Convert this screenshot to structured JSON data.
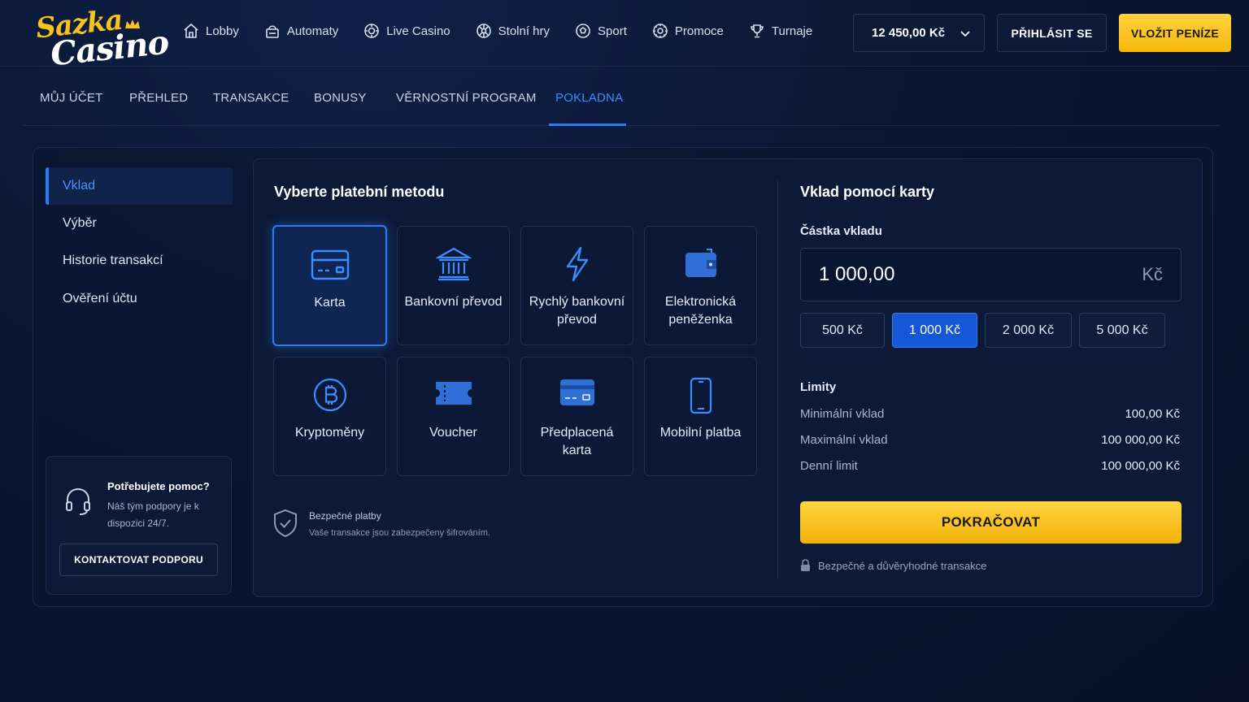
{
  "brand": {
    "logo_top": "Sazka",
    "logo_bottom": "Casino",
    "accent": "#f7c21b",
    "primary_blue": "#2f7cf0"
  },
  "nav": [
    {
      "label": "Lobby",
      "icon": "home-icon"
    },
    {
      "label": "Automaty",
      "icon": "slot-machine-icon"
    },
    {
      "label": "Live Casino",
      "icon": "chip-icon"
    },
    {
      "label": "Stolní hry",
      "icon": "roulette-icon"
    },
    {
      "label": "Sport",
      "icon": "soccer-ball-icon"
    },
    {
      "label": "Promoce",
      "icon": "gift-icon"
    },
    {
      "label": "Turnaje",
      "icon": "trophy-icon"
    }
  ],
  "header": {
    "balance": "12 450,00 Kč",
    "login_label": "PŘIHLÁSIT SE",
    "deposit_label": "VLOŽIT PENÍZE"
  },
  "tabs": [
    {
      "label": "MŮJ ÚČET"
    },
    {
      "label": "PŘEHLED"
    },
    {
      "label": "TRANSAKCE"
    },
    {
      "label": "BONUSY"
    },
    {
      "label": "VĚRNOSTNÍ PROGRAM"
    },
    {
      "label": "POKLADNA",
      "active": true
    }
  ],
  "sidebar": {
    "items": [
      {
        "label": "Vklad",
        "active": true
      },
      {
        "label": "Výběr"
      },
      {
        "label": "Historie transakcí"
      },
      {
        "label": "Ověření účtu"
      }
    ],
    "help": {
      "title": "Potřebujete pomoc?",
      "text": "Náš tým podpory je k dispozici 24/7.",
      "button": "KONTAKTOVAT PODPORU"
    }
  },
  "methods": {
    "title": "Vyberte platební metodu",
    "items": [
      {
        "label": "Karta",
        "icon": "credit-card-icon",
        "active": true
      },
      {
        "label": "Bankovní převod",
        "icon": "bank-icon"
      },
      {
        "label": "Rychlý bankovní převod",
        "icon": "lightning-icon"
      },
      {
        "label": "Elektronická peněženka",
        "icon": "wallet-icon"
      },
      {
        "label": "Kryptoměny",
        "icon": "bitcoin-icon"
      },
      {
        "label": "Voucher",
        "icon": "voucher-icon"
      },
      {
        "label": "Předplacená karta",
        "icon": "prepaid-card-icon"
      },
      {
        "label": "Mobilní platba",
        "icon": "mobile-phone-icon"
      }
    ],
    "secure_title": "Bezpečné platby",
    "secure_text": "Vaše transakce jsou zabezpečeny šifrováním."
  },
  "deposit": {
    "title": "Vklad pomocí karty",
    "amount_label": "Částka vkladu",
    "amount_value": "1 000,00",
    "currency": "Kč",
    "presets": [
      {
        "label": "500 Kč"
      },
      {
        "label": "1 000 Kč",
        "active": true
      },
      {
        "label": "2 000 Kč"
      },
      {
        "label": "5 000 Kč"
      }
    ],
    "limits_label": "Limity",
    "limits": [
      {
        "k": "Minimální vklad",
        "v": "100,00 Kč"
      },
      {
        "k": "Maximální vklad",
        "v": "100 000,00 Kč"
      },
      {
        "k": "Denní limit",
        "v": "100 000,00 Kč"
      }
    ],
    "continue_label": "POKRAČOVAT",
    "safe_note": "Bezpečné a důvěryhodné transakce"
  }
}
